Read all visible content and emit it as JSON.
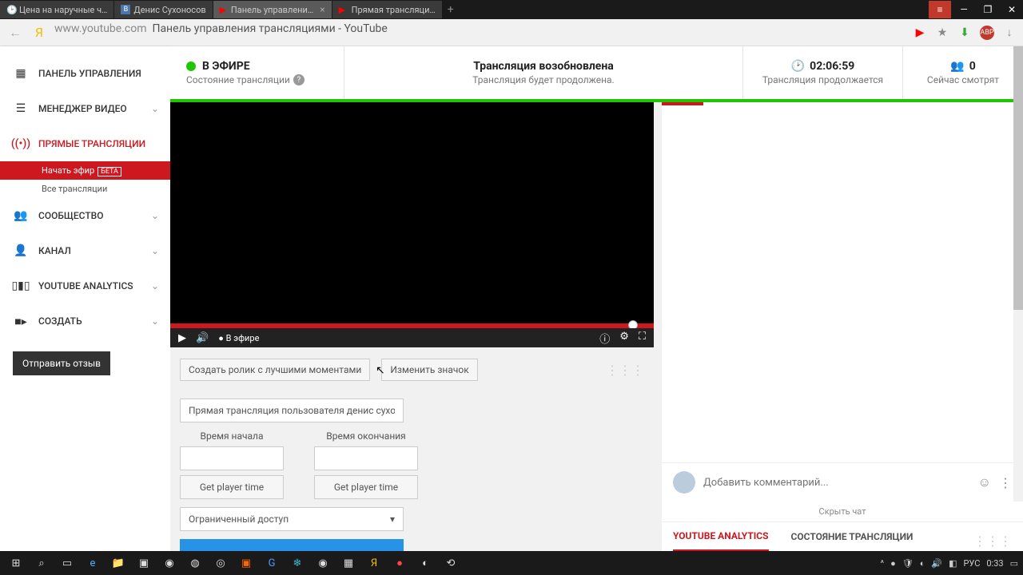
{
  "browser": {
    "tabs": [
      {
        "label": "Цена на наручные ч…",
        "favicon": "🕑"
      },
      {
        "label": "Денис Сухоносов",
        "favicon": "В"
      },
      {
        "label": "Панель управлени…",
        "favicon": "▶"
      },
      {
        "label": "Прямая трансляци…",
        "favicon": "▶"
      }
    ],
    "url_domain": "www.youtube.com",
    "url_title": "Панель управления трансляциями - YouTube"
  },
  "sidebar": {
    "items": [
      {
        "label": "ПАНЕЛЬ УПРАВЛЕНИЯ",
        "icon": "▦"
      },
      {
        "label": "МЕНЕДЖЕР ВИДЕО",
        "icon": "☰",
        "chev": true
      },
      {
        "label": "ПРЯМЫЕ ТРАНСЛЯЦИИ",
        "icon": "((•))",
        "live": true
      },
      {
        "label": "СООБЩЕСТВО",
        "icon": "👥",
        "chev": true
      },
      {
        "label": "КАНАЛ",
        "icon": "👤",
        "chev": true
      },
      {
        "label": "YOUTUBE ANALYTICS",
        "icon": "▯▮▯",
        "chev": true
      },
      {
        "label": "СОЗДАТЬ",
        "icon": "■▸",
        "chev": true
      }
    ],
    "start_live": "Начать эфир",
    "beta": "БЕТА",
    "all_live": "Все трансляции",
    "send_feedback": "Отправить отзыв"
  },
  "topbar": {
    "status_title": "В ЭФИРЕ",
    "status_sub": "Состояние трансляции",
    "resume_title": "Трансляция возобновлена",
    "resume_sub": "Трансляция будет продолжена.",
    "time": "02:06:59",
    "time_sub": "Трансляция продолжается",
    "viewers": "0",
    "viewers_sub": "Сейчас смотрят"
  },
  "player": {
    "live_label": "В эфире"
  },
  "actions": {
    "create_clip": "Создать ролик с лучшими моментами",
    "change_thumb": "Изменить значок"
  },
  "form": {
    "title_value": "Прямая трансляция пользователя денис сухо",
    "start_label": "Время начала",
    "end_label": "Время окончания",
    "get_time": "Get player time",
    "privacy": "Ограниченный доступ"
  },
  "chat": {
    "placeholder": "Добавить комментарий...",
    "hide": "Скрыть чат"
  },
  "tabs": {
    "analytics": "YOUTUBE ANALYTICS",
    "stream_state": "СОСТОЯНИЕ ТРАНСЛЯЦИИ"
  },
  "tray": {
    "lang": "РУС",
    "time": "0:33"
  }
}
